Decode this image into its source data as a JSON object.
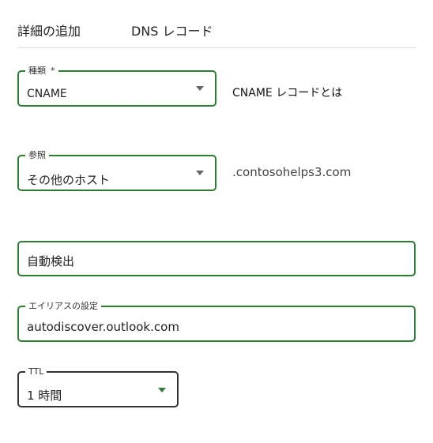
{
  "tabs": [
    {
      "label": "詳細の追加"
    },
    {
      "label": "DNS レコード"
    }
  ],
  "type_field": {
    "legend": "種類",
    "required_mark": "*",
    "value": "CNAME"
  },
  "cname_help_link": "CNAME レコードとは",
  "reference_field": {
    "legend": "参照",
    "value": "その他のホスト"
  },
  "domain_suffix": ".contosohelps3.com",
  "host_field": {
    "value": "自動検出"
  },
  "alias_field": {
    "legend": "エイリアスの設定",
    "value": "autodiscover.outlook.com"
  },
  "ttl_field": {
    "legend": "TTL",
    "value": "1 時間"
  },
  "colors": {
    "accent_green": "#2e7d32",
    "border_dark": "#333333"
  }
}
